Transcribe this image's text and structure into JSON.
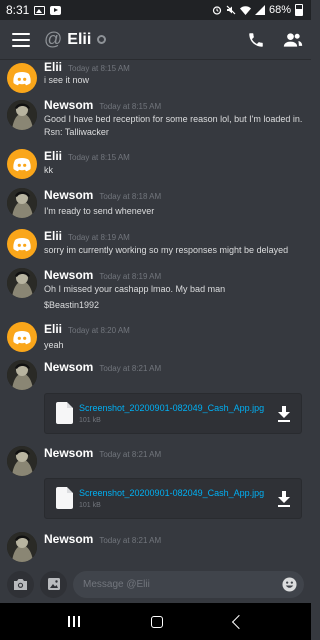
{
  "status_bar": {
    "time": "8:31",
    "battery": "68%",
    "icons": [
      "gallery-icon",
      "youtube-icon",
      "alarm-icon",
      "mute-icon",
      "wifi-icon",
      "signal-icon",
      "battery-icon"
    ]
  },
  "header": {
    "channel_prefix": "@",
    "channel_name": "Elii",
    "icons": [
      "menu-icon",
      "phone-icon",
      "members-icon"
    ]
  },
  "messages": [
    {
      "author": "Elii",
      "timestamp": "Today at 8:15 AM",
      "lines": [
        "i see it now"
      ]
    },
    {
      "author": "Newsom",
      "timestamp": "Today at 8:15 AM",
      "lines": [
        "Good I have bed reception for some reason lol, but I'm loaded in.",
        "Rsn: Talliwacker"
      ]
    },
    {
      "author": "Elii",
      "timestamp": "Today at 8:15 AM",
      "lines": [
        "kk"
      ]
    },
    {
      "author": "Newsom",
      "timestamp": "Today at 8:18 AM",
      "lines": [
        "I'm ready to send whenever"
      ]
    },
    {
      "author": "Elii",
      "timestamp": "Today at 8:19 AM",
      "lines": [
        "sorry im currently working so my responses might be delayed"
      ]
    },
    {
      "author": "Newsom",
      "timestamp": "Today at 8:19 AM",
      "lines": [
        "Oh I missed your cashapp lmao. My bad man"
      ],
      "extra_line": "$Beastin1992"
    },
    {
      "author": "Elii",
      "timestamp": "Today at 8:20 AM",
      "lines": [
        "yeah"
      ]
    },
    {
      "author": "Newsom",
      "timestamp": "Today at 8:21 AM",
      "attachment": {
        "name": "Screenshot_20200901-082049_Cash_App.jpg",
        "size": "101 kB"
      }
    },
    {
      "author": "Newsom",
      "timestamp": "Today at 8:21 AM",
      "attachment": {
        "name": "Screenshot_20200901-082049_Cash_App.jpg",
        "size": "101 kB"
      }
    },
    {
      "author": "Newsom",
      "timestamp": "Today at 8:21 AM"
    }
  ],
  "composer": {
    "placeholder": "Message @Elii",
    "icons": [
      "camera-icon",
      "gallery-icon",
      "emoji-icon"
    ]
  },
  "colors": {
    "background": "#36393f",
    "link": "#00b0f4",
    "elii_avatar": "#faa61a",
    "attachment_bg": "#2f3136"
  }
}
